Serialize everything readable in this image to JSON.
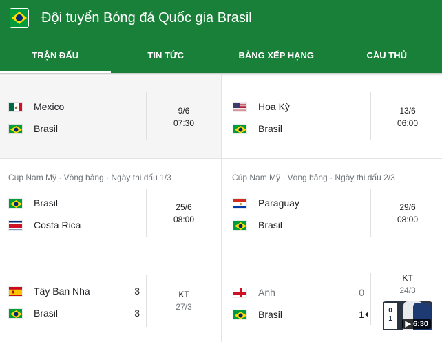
{
  "header": {
    "title": "Đội tuyển Bóng đá Quốc gia Brasil",
    "background": "#188038"
  },
  "tabs": [
    {
      "label": "TRẬN ĐẤU",
      "active": true
    },
    {
      "label": "TIN TỨC",
      "active": false
    },
    {
      "label": "BẢNG XẾP HẠNG",
      "active": false
    },
    {
      "label": "CẦU THỦ",
      "active": false
    }
  ],
  "matches": [
    {
      "subtitle": "",
      "home": {
        "name": "Mexico",
        "flag": "mexico-flag-icon"
      },
      "away": {
        "name": "Brasil",
        "flag": "brazil-flag-icon"
      },
      "date": "9/6",
      "time": "07:30"
    },
    {
      "subtitle": "",
      "home": {
        "name": "Hoa Kỳ",
        "flag": "usa-flag-icon"
      },
      "away": {
        "name": "Brasil",
        "flag": "brazil-flag-icon"
      },
      "date": "13/6",
      "time": "06:00"
    },
    {
      "subtitle": "Cúp Nam Mỹ · Vòng bảng · Ngày thi đấu 1/3",
      "home": {
        "name": "Brasil",
        "flag": "brazil-flag-icon"
      },
      "away": {
        "name": "Costa Rica",
        "flag": "costa-rica-flag-icon"
      },
      "date": "25/6",
      "time": "08:00"
    },
    {
      "subtitle": "Cúp Nam Mỹ · Vòng bảng · Ngày thi đấu 2/3",
      "home": {
        "name": "Paraguay",
        "flag": "paraguay-flag-icon"
      },
      "away": {
        "name": "Brasil",
        "flag": "brazil-flag-icon"
      },
      "date": "29/6",
      "time": "08:00"
    },
    {
      "subtitle": "",
      "home": {
        "name": "Tây Ban Nha",
        "flag": "spain-flag-icon",
        "score": "3"
      },
      "away": {
        "name": "Brasil",
        "flag": "brazil-flag-icon",
        "score": "3"
      },
      "status": "KT",
      "date": "27/3"
    },
    {
      "subtitle": "",
      "home": {
        "name": "Anh",
        "flag": "england-flag-icon",
        "score": "0"
      },
      "away": {
        "name": "Brasil",
        "flag": "brazil-flag-icon",
        "score": "1"
      },
      "status": "KT",
      "date": "24/3",
      "video": {
        "duration": "6:30",
        "scoreboard": [
          "0",
          "1"
        ]
      }
    }
  ]
}
